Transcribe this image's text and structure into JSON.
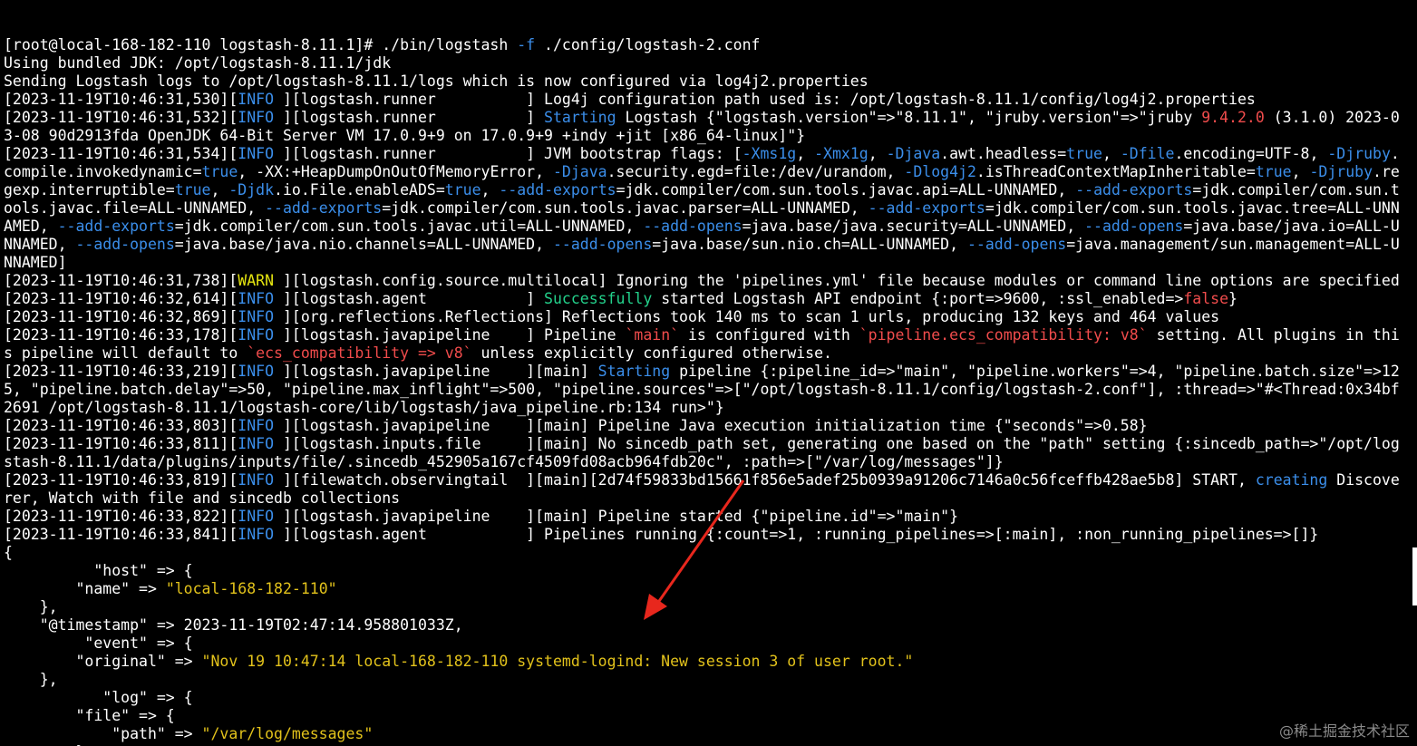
{
  "terminal": {
    "lines": [
      {
        "segs": [
          {
            "t": "[root@local-168-182-110 logstash-8.11.1]# ./bin/logstash ",
            "c": "w"
          },
          {
            "t": "-f",
            "c": "b"
          },
          {
            "t": " ./config/logstash-2.conf",
            "c": "w"
          }
        ]
      },
      {
        "segs": [
          {
            "t": "Using bundled JDK: /opt/logstash-8.11.1/jdk",
            "c": "w"
          }
        ]
      },
      {
        "segs": [
          {
            "t": "Sending Logstash logs to /opt/logstash-8.11.1/logs which is now configured via log4j2.properties",
            "c": "w"
          }
        ]
      },
      {
        "segs": [
          {
            "t": "[2023-11-19T10:46:31,530][",
            "c": "w"
          },
          {
            "t": "INFO",
            "c": "b"
          },
          {
            "t": " ][logstash.runner          ] Log4j configuration path used is: /opt/logstash-8.11.1/config/log4j2.properties",
            "c": "w"
          }
        ]
      },
      {
        "segs": [
          {
            "t": "[2023-11-19T10:46:31,532][",
            "c": "w"
          },
          {
            "t": "INFO",
            "c": "b"
          },
          {
            "t": " ][logstash.runner          ] ",
            "c": "w"
          },
          {
            "t": "Starting",
            "c": "b"
          },
          {
            "t": " Logstash {\"logstash.version\"=>\"8.11.1\", \"jruby.version\"=>\"jruby ",
            "c": "w"
          },
          {
            "t": "9.4.2.0",
            "c": "r"
          },
          {
            "t": " (3.1.0) 2023-0",
            "c": "w"
          }
        ]
      },
      {
        "segs": [
          {
            "t": "3-08 90d2913fda OpenJDK 64-Bit Server VM 17.0.9+9 on 17.0.9+9 +indy +jit [x86_64-linux]\"}",
            "c": "w"
          }
        ]
      },
      {
        "segs": [
          {
            "t": "[2023-11-19T10:46:31,534][",
            "c": "w"
          },
          {
            "t": "INFO",
            "c": "b"
          },
          {
            "t": " ][logstash.runner          ] JVM bootstrap flags: [",
            "c": "w"
          },
          {
            "t": "-Xms1g",
            "c": "b"
          },
          {
            "t": ", ",
            "c": "w"
          },
          {
            "t": "-Xmx1g",
            "c": "b"
          },
          {
            "t": ", ",
            "c": "w"
          },
          {
            "t": "-Djava",
            "c": "b"
          },
          {
            "t": ".awt.headless=",
            "c": "w"
          },
          {
            "t": "true",
            "c": "b"
          },
          {
            "t": ", ",
            "c": "w"
          },
          {
            "t": "-Dfile",
            "c": "b"
          },
          {
            "t": ".encoding=UTF-8, ",
            "c": "w"
          },
          {
            "t": "-Djruby",
            "c": "b"
          },
          {
            "t": ".",
            "c": "w"
          }
        ]
      },
      {
        "segs": [
          {
            "t": "compile.invokedynamic=",
            "c": "w"
          },
          {
            "t": "true",
            "c": "b"
          },
          {
            "t": ", -XX:+HeapDumpOnOutOfMemoryError, ",
            "c": "w"
          },
          {
            "t": "-Djava",
            "c": "b"
          },
          {
            "t": ".security.egd=file:/dev/urandom, ",
            "c": "w"
          },
          {
            "t": "-Dlog4j2",
            "c": "b"
          },
          {
            "t": ".isThreadContextMapInheritable=",
            "c": "w"
          },
          {
            "t": "true",
            "c": "b"
          },
          {
            "t": ", ",
            "c": "w"
          },
          {
            "t": "-Djruby",
            "c": "b"
          },
          {
            "t": ".re",
            "c": "w"
          }
        ]
      },
      {
        "segs": [
          {
            "t": "gexp.interruptible=",
            "c": "w"
          },
          {
            "t": "true",
            "c": "b"
          },
          {
            "t": ", ",
            "c": "w"
          },
          {
            "t": "-Djdk",
            "c": "b"
          },
          {
            "t": ".io.File.enableADS=",
            "c": "w"
          },
          {
            "t": "true",
            "c": "b"
          },
          {
            "t": ", ",
            "c": "w"
          },
          {
            "t": "--add-exports",
            "c": "b"
          },
          {
            "t": "=jdk.compiler/com.sun.tools.javac.api=ALL-UNNAMED, ",
            "c": "w"
          },
          {
            "t": "--add-exports",
            "c": "b"
          },
          {
            "t": "=jdk.compiler/com.sun.t",
            "c": "w"
          }
        ]
      },
      {
        "segs": [
          {
            "t": "ools.javac.file=ALL-UNNAMED, ",
            "c": "w"
          },
          {
            "t": "--add-exports",
            "c": "b"
          },
          {
            "t": "=jdk.compiler/com.sun.tools.javac.parser=ALL-UNNAMED, ",
            "c": "w"
          },
          {
            "t": "--add-exports",
            "c": "b"
          },
          {
            "t": "=jdk.compiler/com.sun.tools.javac.tree=ALL-UNN",
            "c": "w"
          }
        ]
      },
      {
        "segs": [
          {
            "t": "AMED, ",
            "c": "w"
          },
          {
            "t": "--add-exports",
            "c": "b"
          },
          {
            "t": "=jdk.compiler/com.sun.tools.javac.util=ALL-UNNAMED, ",
            "c": "w"
          },
          {
            "t": "--add-opens",
            "c": "b"
          },
          {
            "t": "=java.base/java.security=ALL-UNNAMED, ",
            "c": "w"
          },
          {
            "t": "--add-opens",
            "c": "b"
          },
          {
            "t": "=java.base/java.io=ALL-U",
            "c": "w"
          }
        ]
      },
      {
        "segs": [
          {
            "t": "NNAMED, ",
            "c": "w"
          },
          {
            "t": "--add-opens",
            "c": "b"
          },
          {
            "t": "=java.base/java.nio.channels=ALL-UNNAMED, ",
            "c": "w"
          },
          {
            "t": "--add-opens",
            "c": "b"
          },
          {
            "t": "=java.base/sun.nio.ch=ALL-UNNAMED, ",
            "c": "w"
          },
          {
            "t": "--add-opens",
            "c": "b"
          },
          {
            "t": "=java.management/sun.management=ALL-U",
            "c": "w"
          }
        ]
      },
      {
        "segs": [
          {
            "t": "NNAMED]",
            "c": "w"
          }
        ]
      },
      {
        "segs": [
          {
            "t": "[2023-11-19T10:46:31,738][",
            "c": "w"
          },
          {
            "t": "WARN",
            "c": "y"
          },
          {
            "t": " ][logstash.config.source.multilocal] Ignoring the 'pipelines.yml' file because modules or command line options are specified",
            "c": "w"
          }
        ]
      },
      {
        "segs": [
          {
            "t": "[2023-11-19T10:46:32,614][",
            "c": "w"
          },
          {
            "t": "INFO",
            "c": "b"
          },
          {
            "t": " ][logstash.agent           ] ",
            "c": "w"
          },
          {
            "t": "Successfully",
            "c": "g"
          },
          {
            "t": " started Logstash API endpoint {:port=>9600, :ssl_enabled=>",
            "c": "w"
          },
          {
            "t": "false",
            "c": "r"
          },
          {
            "t": "}",
            "c": "w"
          }
        ]
      },
      {
        "segs": [
          {
            "t": "[2023-11-19T10:46:32,869][",
            "c": "w"
          },
          {
            "t": "INFO",
            "c": "b"
          },
          {
            "t": " ][org.reflections.Reflections] Reflections took 140 ms to scan 1 urls, producing 132 keys and 464 values",
            "c": "w"
          }
        ]
      },
      {
        "segs": [
          {
            "t": "[2023-11-19T10:46:33,178][",
            "c": "w"
          },
          {
            "t": "INFO",
            "c": "b"
          },
          {
            "t": " ][logstash.javapipeline    ] Pipeline ",
            "c": "w"
          },
          {
            "t": "`main`",
            "c": "r"
          },
          {
            "t": " is configured with ",
            "c": "w"
          },
          {
            "t": "`pipeline.ecs_compatibility: v8`",
            "c": "r"
          },
          {
            "t": " setting. All plugins in thi",
            "c": "w"
          }
        ]
      },
      {
        "segs": [
          {
            "t": "s pipeline will default to ",
            "c": "w"
          },
          {
            "t": "`ecs_compatibility => v8`",
            "c": "r"
          },
          {
            "t": " unless explicitly configured otherwise.",
            "c": "w"
          }
        ]
      },
      {
        "segs": [
          {
            "t": "[2023-11-19T10:46:33,219][",
            "c": "w"
          },
          {
            "t": "INFO",
            "c": "b"
          },
          {
            "t": " ][logstash.javapipeline    ][main] ",
            "c": "w"
          },
          {
            "t": "Starting",
            "c": "b"
          },
          {
            "t": " pipeline {:pipeline_id=>\"main\", \"pipeline.workers\"=>4, \"pipeline.batch.size\"=>12",
            "c": "w"
          }
        ]
      },
      {
        "segs": [
          {
            "t": "5, \"pipeline.batch.delay\"=>50, \"pipeline.max_inflight\"=>500, \"pipeline.sources\"=>[\"/opt/logstash-8.11.1/config/logstash-2.conf\"], :thread=>\"#<Thread:0x34bf",
            "c": "w"
          }
        ]
      },
      {
        "segs": [
          {
            "t": "2691 /opt/logstash-8.11.1/logstash-core/lib/logstash/java_pipeline.rb:134 run>\"}",
            "c": "w"
          }
        ]
      },
      {
        "segs": [
          {
            "t": "[2023-11-19T10:46:33,803][",
            "c": "w"
          },
          {
            "t": "INFO",
            "c": "b"
          },
          {
            "t": " ][logstash.javapipeline    ][main] Pipeline Java execution initialization time {\"seconds\"=>0.58}",
            "c": "w"
          }
        ]
      },
      {
        "segs": [
          {
            "t": "[2023-11-19T10:46:33,811][",
            "c": "w"
          },
          {
            "t": "INFO",
            "c": "b"
          },
          {
            "t": " ][logstash.inputs.file     ][main] No sincedb_path set, generating one based on the \"path\" setting {:sincedb_path=>\"/opt/log",
            "c": "w"
          }
        ]
      },
      {
        "segs": [
          {
            "t": "stash-8.11.1/data/plugins/inputs/file/.sincedb_452905a167cf4509fd08acb964fdb20c\", :path=>[\"/var/log/messages\"]}",
            "c": "w"
          }
        ]
      },
      {
        "segs": [
          {
            "t": "[2023-11-19T10:46:33,819][",
            "c": "w"
          },
          {
            "t": "INFO",
            "c": "b"
          },
          {
            "t": " ][filewatch.observingtail  ][main][2d74f59833bd15661f856e5adef25b0939a91206c7146a0c56fceffb428ae5b8] START, ",
            "c": "w"
          },
          {
            "t": "creating",
            "c": "b"
          },
          {
            "t": " Discove",
            "c": "w"
          }
        ]
      },
      {
        "segs": [
          {
            "t": "rer, Watch with file and sincedb collections",
            "c": "w"
          }
        ]
      },
      {
        "segs": [
          {
            "t": "[2023-11-19T10:46:33,822][",
            "c": "w"
          },
          {
            "t": "INFO",
            "c": "b"
          },
          {
            "t": " ][logstash.javapipeline    ][main] Pipeline started {\"pipeline.id\"=>\"main\"}",
            "c": "w"
          }
        ]
      },
      {
        "segs": [
          {
            "t": "[2023-11-19T10:46:33,841][",
            "c": "w"
          },
          {
            "t": "INFO",
            "c": "b"
          },
          {
            "t": " ][logstash.agent           ] Pipelines running {:count=>1, :running_pipelines=>[:main], :non_running_pipelines=>[]}",
            "c": "w"
          }
        ]
      },
      {
        "segs": [
          {
            "t": "{",
            "c": "w"
          }
        ]
      },
      {
        "segs": [
          {
            "t": "          \"host\" => {",
            "c": "w"
          }
        ]
      },
      {
        "segs": [
          {
            "t": "        \"name\" => ",
            "c": "w"
          },
          {
            "t": "\"local-168-182-110\"",
            "c": "o"
          }
        ]
      },
      {
        "segs": [
          {
            "t": "    },",
            "c": "w"
          }
        ]
      },
      {
        "segs": [
          {
            "t": "    \"@timestamp\" => 2023-11-19T02:47:14.958801033Z,",
            "c": "w"
          }
        ]
      },
      {
        "segs": [
          {
            "t": "         \"event\" => {",
            "c": "w"
          }
        ]
      },
      {
        "segs": [
          {
            "t": "        \"original\" => ",
            "c": "w"
          },
          {
            "t": "\"Nov 19 10:47:14 local-168-182-110 systemd-logind: New session 3 of user root.\"",
            "c": "o"
          }
        ]
      },
      {
        "segs": [
          {
            "t": "    },",
            "c": "w"
          }
        ]
      },
      {
        "segs": [
          {
            "t": "           \"log\" => {",
            "c": "w"
          }
        ]
      },
      {
        "segs": [
          {
            "t": "        \"file\" => {",
            "c": "w"
          }
        ]
      },
      {
        "segs": [
          {
            "t": "            \"path\" => ",
            "c": "w"
          },
          {
            "t": "\"/var/log/messages\"",
            "c": "o"
          }
        ]
      },
      {
        "segs": [
          {
            "t": "        }",
            "c": "w"
          }
        ]
      },
      {
        "segs": [
          {
            "t": "    },",
            "c": "w"
          }
        ]
      }
    ]
  },
  "watermark": "@稀土掘金技术社区",
  "colors": {
    "w": "#ffffff",
    "b": "#3b8eea",
    "g": "#23d18b",
    "y": "#e5e510",
    "r": "#f14c4c",
    "o": "#e2c21b",
    "arrow": "#e8271d"
  },
  "annotation": {
    "icon": "red-arrow-icon"
  }
}
